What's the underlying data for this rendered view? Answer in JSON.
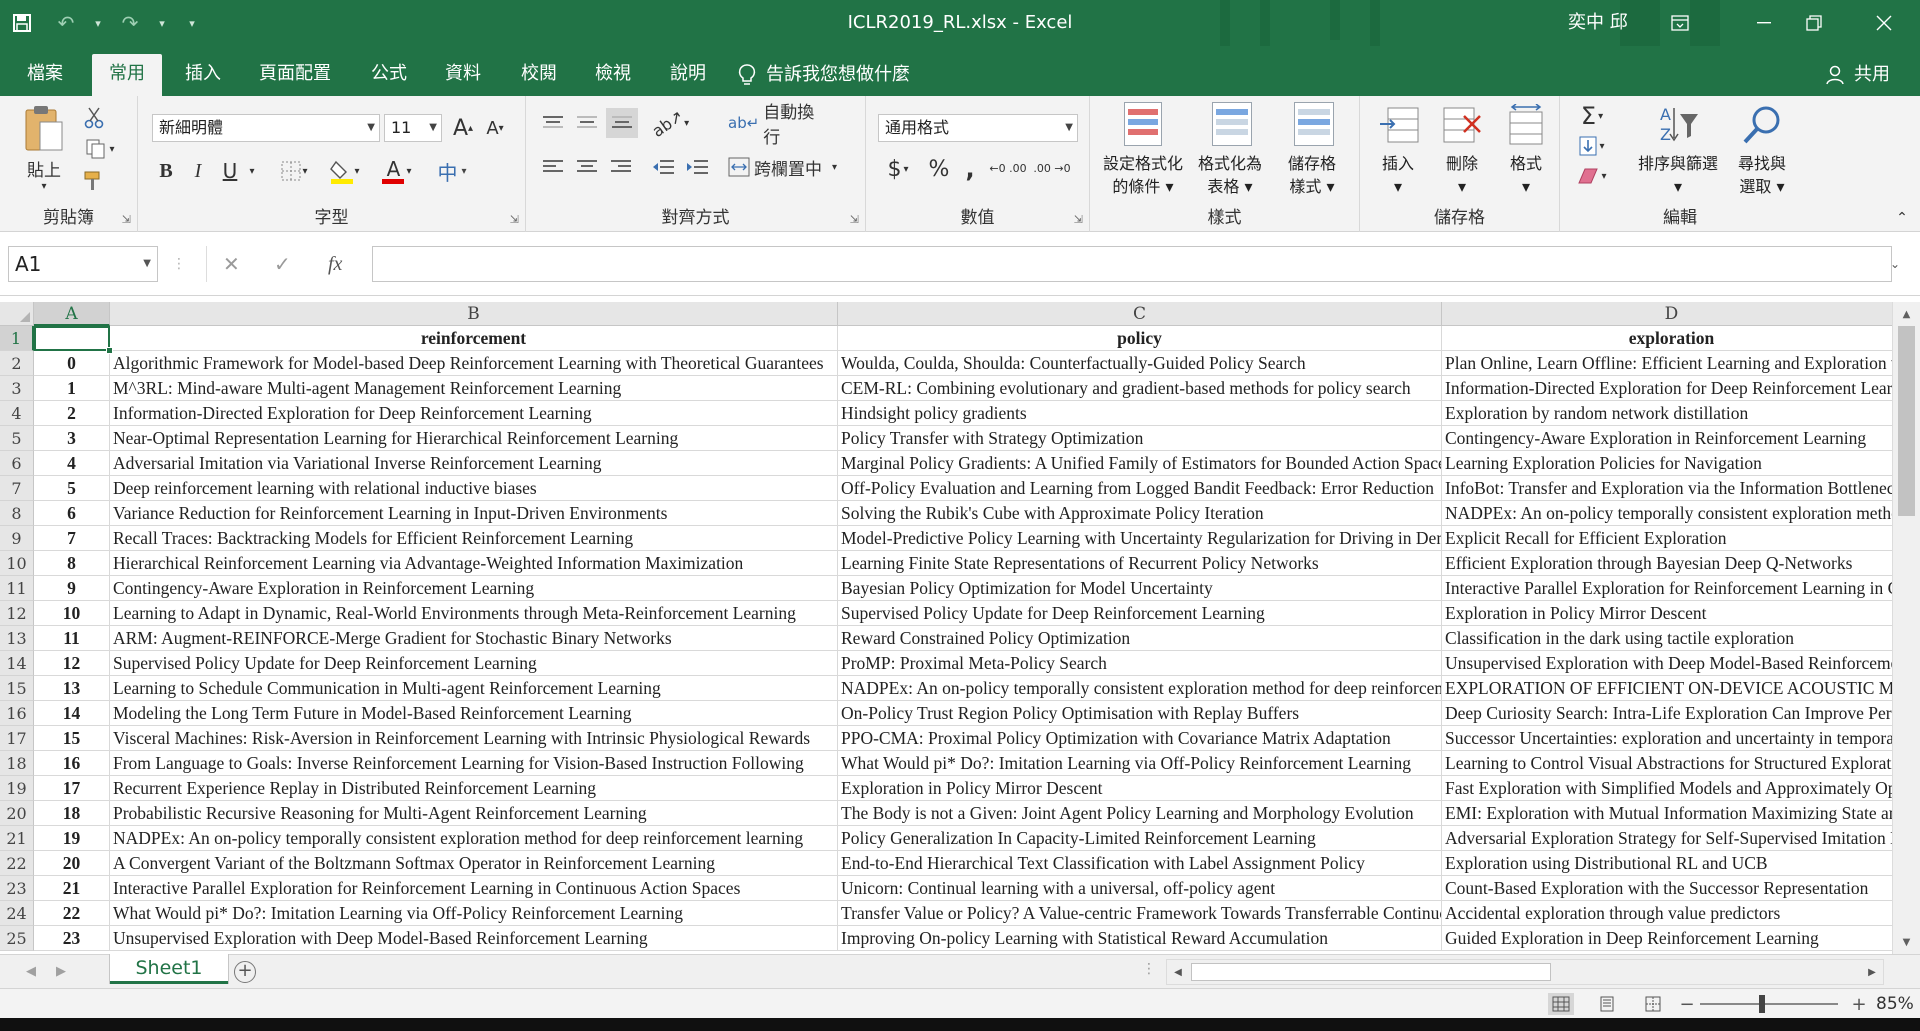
{
  "window": {
    "title": "ICLR2019_RL.xlsx  -  Excel",
    "user": "奕中 邱",
    "accent": "#217346"
  },
  "qat": {
    "save_icon": "save-icon",
    "undo_icon": "undo-icon",
    "redo_icon": "redo-icon"
  },
  "tabs": [
    "檔案",
    "常用",
    "插入",
    "頁面配置",
    "公式",
    "資料",
    "校閱",
    "檢視",
    "說明"
  ],
  "active_tab": "常用",
  "tell_me": "告訴我您想做什麼",
  "share": "共用",
  "ribbon": {
    "clipboard": {
      "label": "剪貼簿",
      "paste": "貼上"
    },
    "font": {
      "label": "字型",
      "name": "新細明體",
      "size": "11",
      "bold": "B",
      "italic": "I",
      "underline": "U",
      "grow": "A",
      "shrink": "A",
      "font_color": "A",
      "phonetic": "中"
    },
    "alignment": {
      "label": "對齊方式",
      "wrap": "自動換行",
      "merge": "跨欄置中"
    },
    "number": {
      "label": "數值",
      "format": "通用格式",
      "currency": "$",
      "percent": "%",
      "comma": ",",
      "inc_dec": "←0 .00",
      "dec_dec": ".00 →0"
    },
    "styles": {
      "label": "樣式",
      "cond": [
        "設定格式化",
        "的條件"
      ],
      "table": [
        "格式化為",
        "表格"
      ],
      "cell": [
        "儲存格",
        "樣式"
      ]
    },
    "cells": {
      "label": "儲存格",
      "insert": "插入",
      "delete": "刪除",
      "format": "格式"
    },
    "editing": {
      "label": "編輯",
      "sort": "排序與篩選",
      "find": [
        "尋找與",
        "選取"
      ]
    }
  },
  "formula_bar": {
    "name_box": "A1",
    "fx": "fx",
    "cancel": "✕",
    "enter": "✓",
    "content": ""
  },
  "grid": {
    "columns": [
      "A",
      "B",
      "C",
      "D"
    ],
    "row_numbers": [
      "1",
      "2",
      "3",
      "4",
      "5",
      "6",
      "7",
      "8",
      "9",
      "10",
      "11",
      "12",
      "13",
      "14",
      "15",
      "16",
      "17",
      "18",
      "19",
      "20",
      "21",
      "22",
      "23",
      "24",
      "25"
    ],
    "header": [
      "",
      "reinforcement",
      "policy",
      "exploration"
    ],
    "rows": [
      [
        "0",
        "Algorithmic Framework for Model-based Deep Reinforcement Learning with Theoretical Guarantees",
        "Woulda, Coulda, Shoulda: Counterfactually-Guided Policy Search",
        "Plan Online, Learn Offline: Efficient Learning and Exploration via Model-Based Control"
      ],
      [
        "1",
        "M^3RL: Mind-aware Multi-agent Management Reinforcement Learning",
        "CEM-RL: Combining evolutionary and gradient-based methods for policy search",
        "Information-Directed Exploration for Deep Reinforcement Learning"
      ],
      [
        "2",
        "Information-Directed Exploration for Deep Reinforcement Learning",
        "Hindsight policy gradients",
        "Exploration by random network distillation"
      ],
      [
        "3",
        "Near-Optimal Representation Learning for Hierarchical Reinforcement Learning",
        "Policy Transfer with Strategy Optimization",
        "Contingency-Aware Exploration in Reinforcement Learning"
      ],
      [
        "4",
        "Adversarial Imitation via Variational Inverse Reinforcement Learning",
        "Marginal Policy Gradients: A Unified Family of Estimators for Bounded Action Spaces",
        "Learning Exploration Policies for Navigation"
      ],
      [
        "5",
        "Deep reinforcement learning with relational inductive biases",
        "Off-Policy Evaluation and Learning from Logged Bandit Feedback: Error Reduction",
        "InfoBot: Transfer and Exploration via the Information Bottleneck"
      ],
      [
        "6",
        "Variance Reduction for Reinforcement Learning in Input-Driven Environments",
        "Solving the Rubik's Cube with Approximate Policy Iteration",
        "NADPEx: An on-policy temporally consistent exploration method"
      ],
      [
        "7",
        "Recall Traces: Backtracking Models for Efficient Reinforcement Learning",
        "Model-Predictive Policy Learning with Uncertainty Regularization for Driving in Dense Traffic",
        "Explicit Recall for Efficient Exploration"
      ],
      [
        "8",
        "Hierarchical Reinforcement Learning via Advantage-Weighted Information Maximization",
        "Learning Finite State Representations of Recurrent Policy Networks",
        "Efficient Exploration through Bayesian Deep Q-Networks"
      ],
      [
        "9",
        "Contingency-Aware Exploration in Reinforcement Learning",
        "Bayesian Policy Optimization for Model Uncertainty",
        "Interactive Parallel Exploration for Reinforcement Learning in Continuous Action Spaces"
      ],
      [
        "10",
        "Learning to Adapt in Dynamic, Real-World Environments through Meta-Reinforcement Learning",
        "Supervised Policy Update for Deep Reinforcement Learning",
        "Exploration in Policy Mirror Descent"
      ],
      [
        "11",
        "ARM: Augment-REINFORCE-Merge Gradient for Stochastic Binary Networks",
        "Reward Constrained Policy Optimization",
        "Classification in the dark using tactile exploration"
      ],
      [
        "12",
        "Supervised Policy Update for Deep Reinforcement Learning",
        "ProMP: Proximal Meta-Policy Search",
        "Unsupervised Exploration with Deep Model-Based Reinforcement Learning"
      ],
      [
        "13",
        "Learning to Schedule Communication in Multi-agent Reinforcement Learning",
        "NADPEx: An on-policy temporally consistent exploration method for deep reinforcement learning",
        "EXPLORATION OF EFFICIENT ON-DEVICE ACOUSTIC MODELING"
      ],
      [
        "14",
        "Modeling the Long Term Future in Model-Based Reinforcement Learning",
        "On-Policy Trust Region Policy Optimisation with Replay Buffers",
        "Deep Curiosity Search: Intra-Life Exploration Can Improve Performance"
      ],
      [
        "15",
        "Visceral Machines: Risk-Aversion in  Reinforcement Learning with Intrinsic Physiological Rewards",
        "PPO-CMA: Proximal Policy Optimization with Covariance Matrix Adaptation",
        "Successor Uncertainties: exploration and uncertainty in temporal difference learning"
      ],
      [
        "16",
        "From Language to Goals: Inverse Reinforcement Learning for Vision-Based Instruction Following",
        "What Would pi* Do?: Imitation Learning via Off-Policy Reinforcement Learning",
        "Learning to Control Visual Abstractions for Structured Exploration"
      ],
      [
        "17",
        "Recurrent Experience Replay in Distributed Reinforcement Learning",
        "Exploration in Policy Mirror Descent",
        "Fast Exploration with Simplified Models and Approximately Optimistic Planning"
      ],
      [
        "18",
        "Probabilistic Recursive Reasoning for Multi-Agent Reinforcement Learning",
        "The Body is not a Given: Joint Agent Policy Learning and Morphology Evolution",
        "EMI: Exploration with Mutual Information Maximizing State and Action Embeddings"
      ],
      [
        "19",
        "NADPEx: An on-policy temporally consistent exploration method for deep reinforcement learning",
        "Policy Generalization In Capacity-Limited Reinforcement Learning",
        "Adversarial Exploration Strategy for Self-Supervised Imitation Learning"
      ],
      [
        "20",
        "A Convergent Variant of the Boltzmann Softmax Operator in Reinforcement Learning",
        "End-to-End Hierarchical Text Classification with Label Assignment Policy",
        "Exploration using Distributional RL and UCB"
      ],
      [
        "21",
        "Interactive Parallel Exploration for Reinforcement Learning in Continuous Action Spaces",
        "Unicorn: Continual learning with a universal, off-policy agent",
        "Count-Based Exploration with the Successor Representation"
      ],
      [
        "22",
        "What Would pi* Do?: Imitation Learning via Off-Policy Reinforcement Learning",
        "Transfer Value or Policy? A Value-centric Framework Towards Transferrable Continuous RL",
        "Accidental exploration through value predictors"
      ],
      [
        "23",
        "Unsupervised Exploration with Deep Model-Based Reinforcement Learning",
        "Improving On-policy Learning with Statistical Reward Accumulation",
        "Guided Exploration in Deep Reinforcement Learning"
      ]
    ]
  },
  "sheets": [
    "Sheet1"
  ],
  "status": {
    "zoom": "85%"
  }
}
